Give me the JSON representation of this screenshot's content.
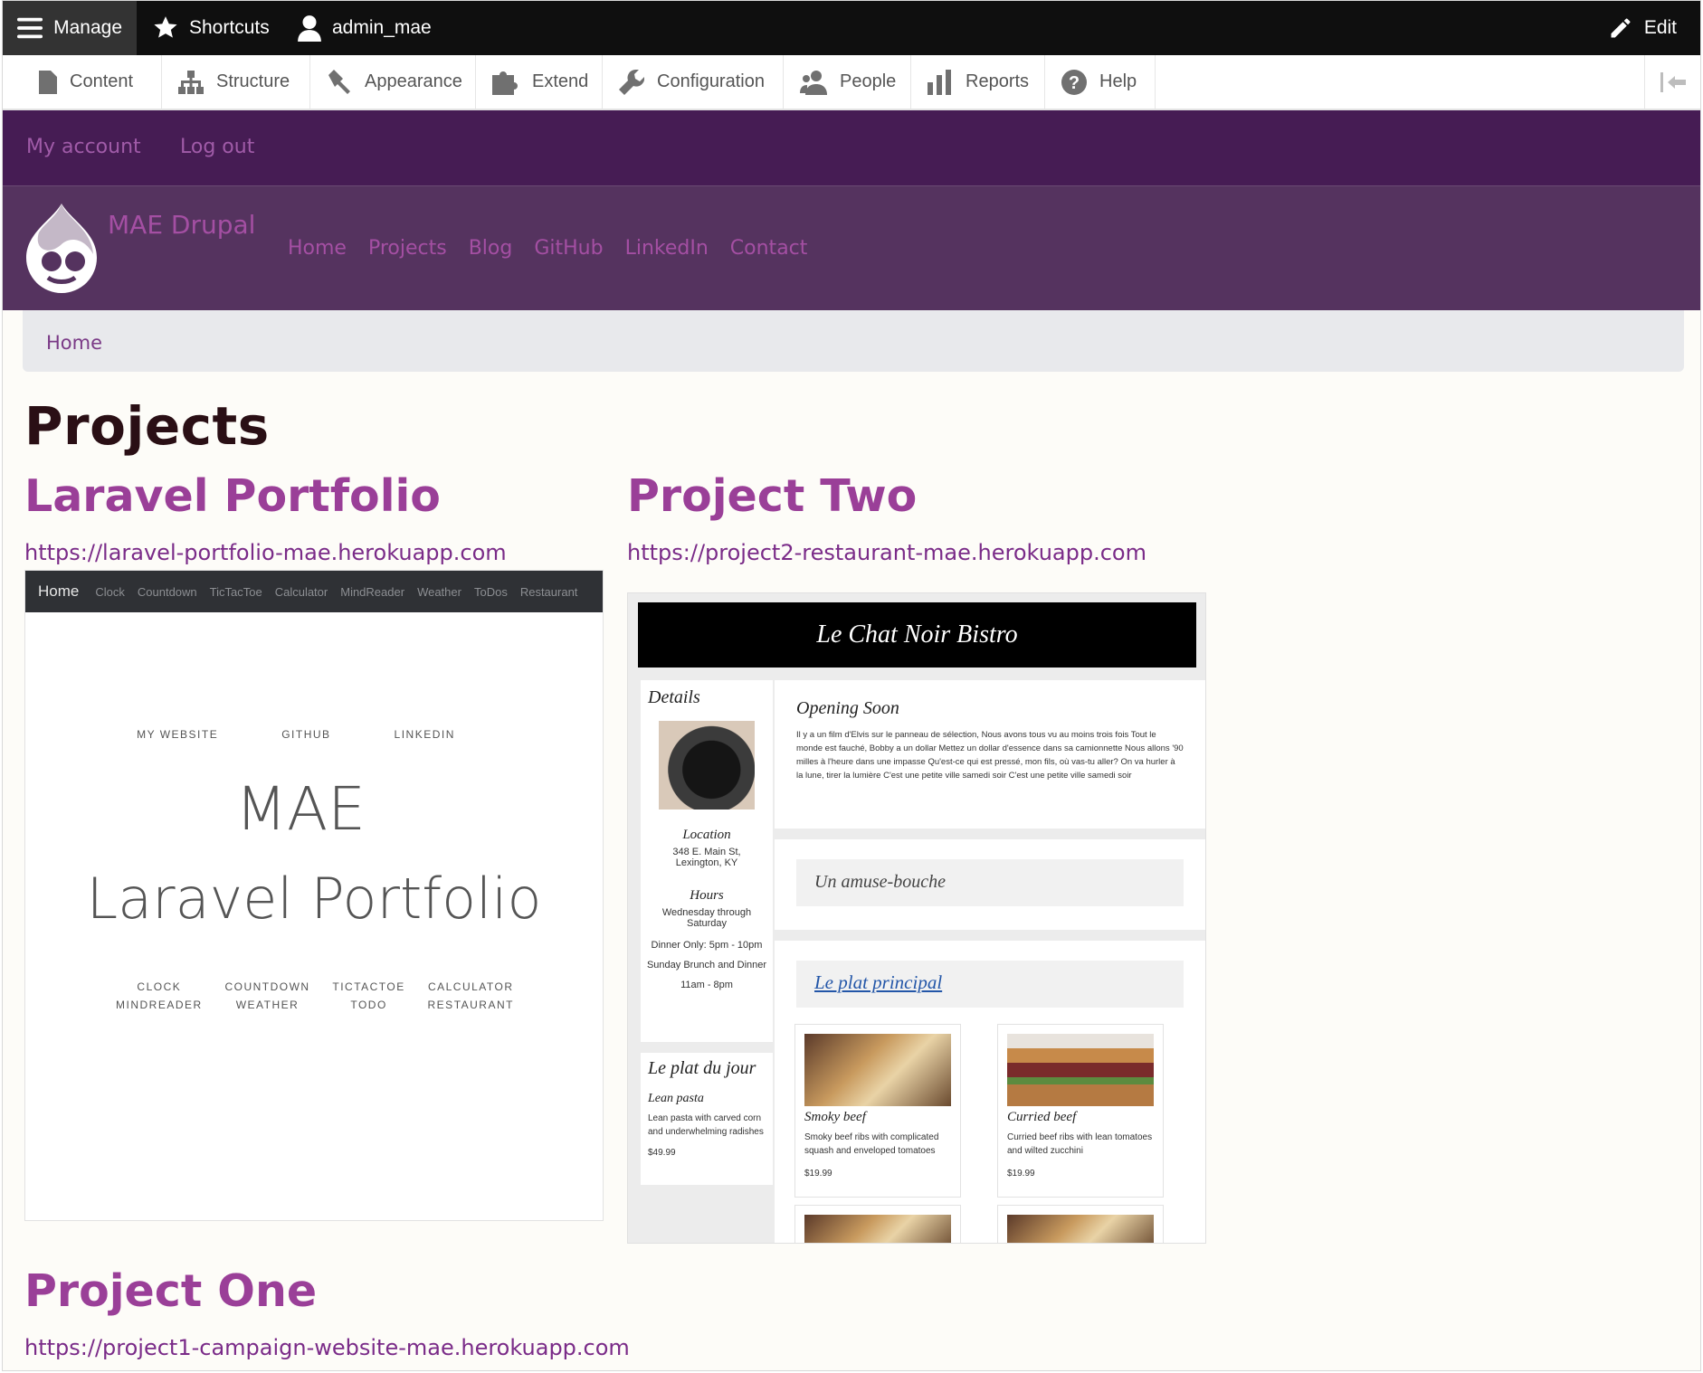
{
  "toolbar": {
    "manage": "Manage",
    "shortcuts": "Shortcuts",
    "user": "admin_mae",
    "edit": "Edit"
  },
  "tray": {
    "items": [
      {
        "label": "Content",
        "icon": "file-icon"
      },
      {
        "label": "Structure",
        "icon": "sitemap-icon"
      },
      {
        "label": "Appearance",
        "icon": "paintbrush-icon"
      },
      {
        "label": "Extend",
        "icon": "puzzle-icon"
      },
      {
        "label": "Configuration",
        "icon": "wrench-icon"
      },
      {
        "label": "People",
        "icon": "people-icon"
      },
      {
        "label": "Reports",
        "icon": "bar-chart-icon"
      },
      {
        "label": "Help",
        "icon": "help-icon"
      }
    ]
  },
  "account": {
    "my_account": "My account",
    "log_out": "Log out"
  },
  "site": {
    "name": "MAE Drupal",
    "nav": [
      "Home",
      "Projects",
      "Blog",
      "GitHub",
      "LinkedIn",
      "Contact"
    ]
  },
  "breadcrumb": {
    "home": "Home"
  },
  "page": {
    "title": "Projects",
    "projects": [
      {
        "title": "Laravel Portfolio",
        "url": "https://laravel-portfolio-mae.herokuapp.com"
      },
      {
        "title": "Project Two",
        "url": "https://project2-restaurant-mae.herokuapp.com"
      },
      {
        "title": "Project One",
        "url": "https://project1-campaign-website-mae.herokuapp.com"
      }
    ]
  },
  "laravel_shot": {
    "nav_brand": "Home",
    "nav_links": [
      "Clock",
      "Countdown",
      "TicTacToe",
      "Calculator",
      "MindReader",
      "Weather",
      "ToDos",
      "Restaurant"
    ],
    "top_links": [
      "MY WEBSITE",
      "GITHUB",
      "LINKEDIN"
    ],
    "heading1": "MAE",
    "heading2": "Laravel Portfolio",
    "bottom_links": [
      "CLOCK",
      "COUNTDOWN",
      "TICTACTOE",
      "CALCULATOR",
      "MINDREADER",
      "WEATHER",
      "TODO",
      "RESTAURANT"
    ]
  },
  "restaurant_shot": {
    "title": "Le Chat Noir Bistro",
    "details": "Details",
    "location_label": "Location",
    "location": "348 E. Main St, Lexington, KY",
    "hours_label": "Hours",
    "hours_days": "Wednesday through Saturday",
    "dinner": "Dinner Only: 5pm - 10pm",
    "brunch": "Sunday Brunch and Dinner",
    "brunch_hours": "11am - 8pm",
    "plat_du_jour": "Le plat du jour",
    "special_name": "Lean pasta",
    "special_desc": "Lean pasta with carved corn and underwhelming radishes",
    "special_price": "$49.99",
    "opening": "Opening Soon",
    "opening_text": "Il y a un film d'Elvis sur le panneau de sélection, Nous avons tous vu au moins trois fois Tout le monde est fauché, Bobby a un dollar Mettez un dollar d'essence dans sa camionnette Nous allons '90 milles à l'heure dans une impasse Qu'est-ce qui est pressé, mon fils, où vas-tu aller? On va hurler à la lune, tirer la lumière C'est une petite ville samedi soir C'est une petite ville samedi soir",
    "amuse": "Un amuse-bouche",
    "principal": "Le plat principal",
    "dish1_name": "Smoky beef",
    "dish1_desc": "Smoky beef ribs with complicated squash and enveloped tomatoes",
    "dish1_price": "$19.99",
    "dish2_name": "Curried beef",
    "dish2_desc": "Curried beef ribs with lean tomatoes and wilted zucchini",
    "dish2_price": "$19.99"
  }
}
